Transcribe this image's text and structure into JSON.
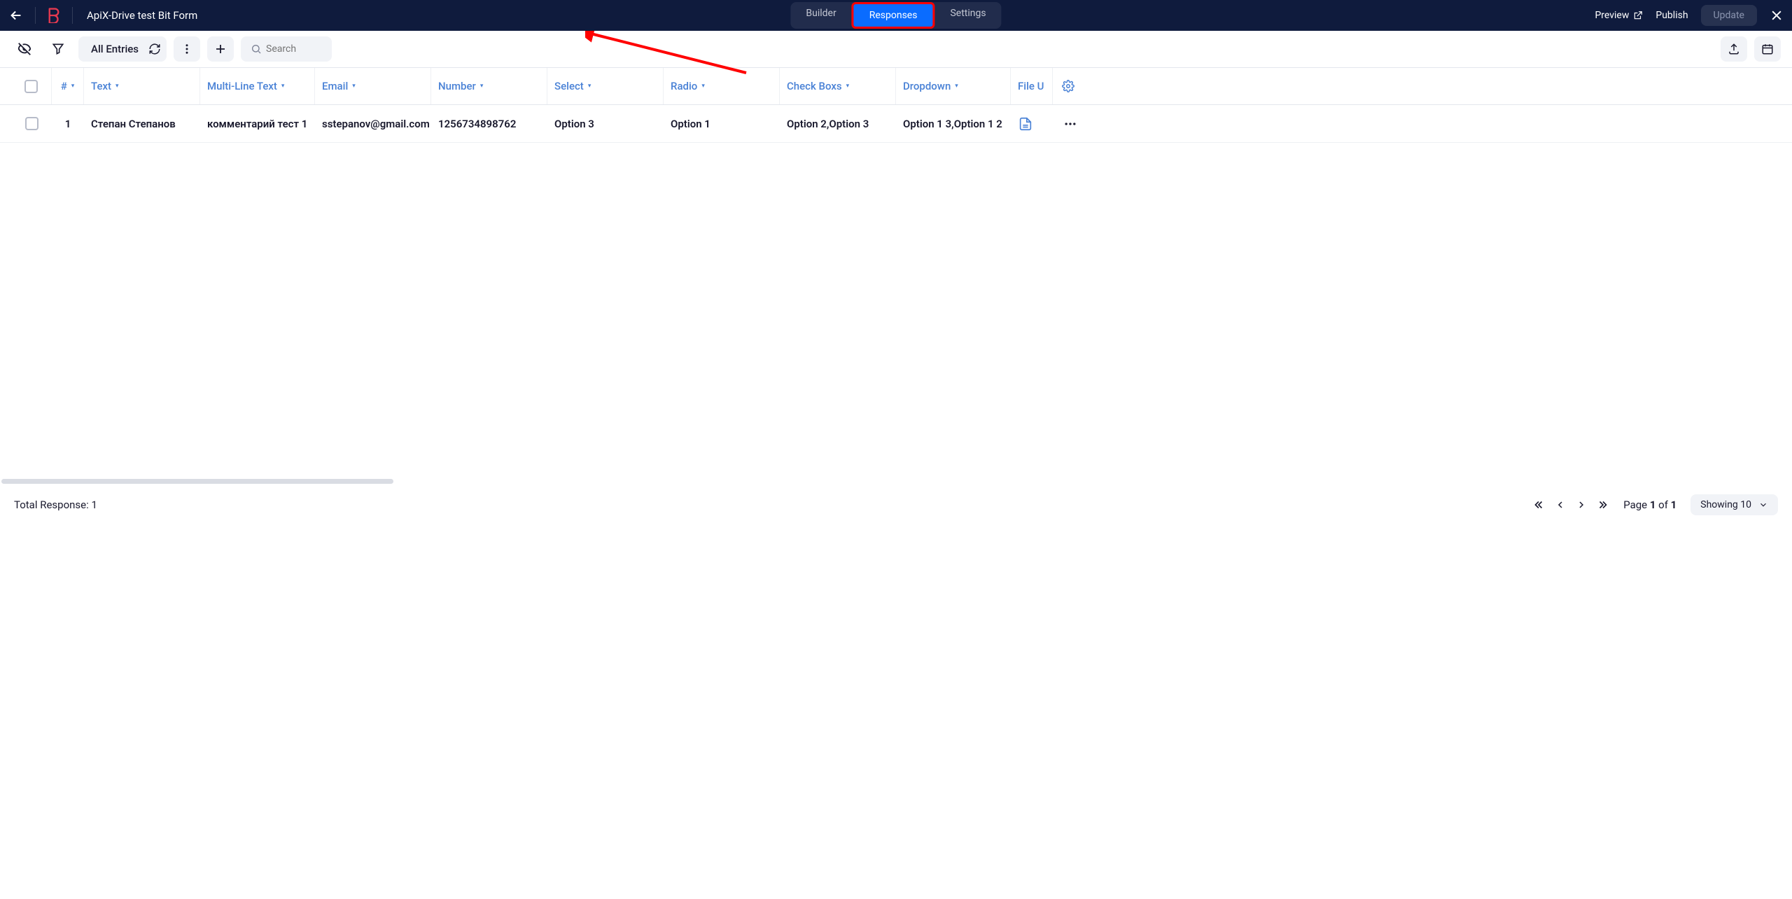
{
  "header": {
    "form_title": "ApiX-Drive test Bit Form",
    "tabs": {
      "builder": "Builder",
      "responses": "Responses",
      "settings": "Settings"
    },
    "preview": "Preview",
    "publish": "Publish",
    "update": "Update"
  },
  "toolbar": {
    "entries_label": "All Entries",
    "search_placeholder": "Search"
  },
  "columns": {
    "idx": "#",
    "text": "Text",
    "mlt": "Multi-Line Text",
    "email": "Email",
    "number": "Number",
    "select": "Select",
    "radio": "Radio",
    "check": "Check Boxs",
    "dropdown": "Dropdown",
    "file": "File U"
  },
  "rows": [
    {
      "idx": "1",
      "text": "Степан Степанов",
      "mlt": "комментарий тест 1",
      "email": "sstepanov@gmail.com",
      "number": "1256734898762",
      "select": "Option 3",
      "radio": "Option 1",
      "check": "Option 2,Option 3",
      "dropdown": "Option 1 3,Option 1 2"
    }
  ],
  "footer": {
    "total_label": "Total Response: 1",
    "page_prefix": "Page ",
    "page_current": "1",
    "page_mid": " of ",
    "page_total": "1",
    "showing_label": "Showing 10"
  }
}
